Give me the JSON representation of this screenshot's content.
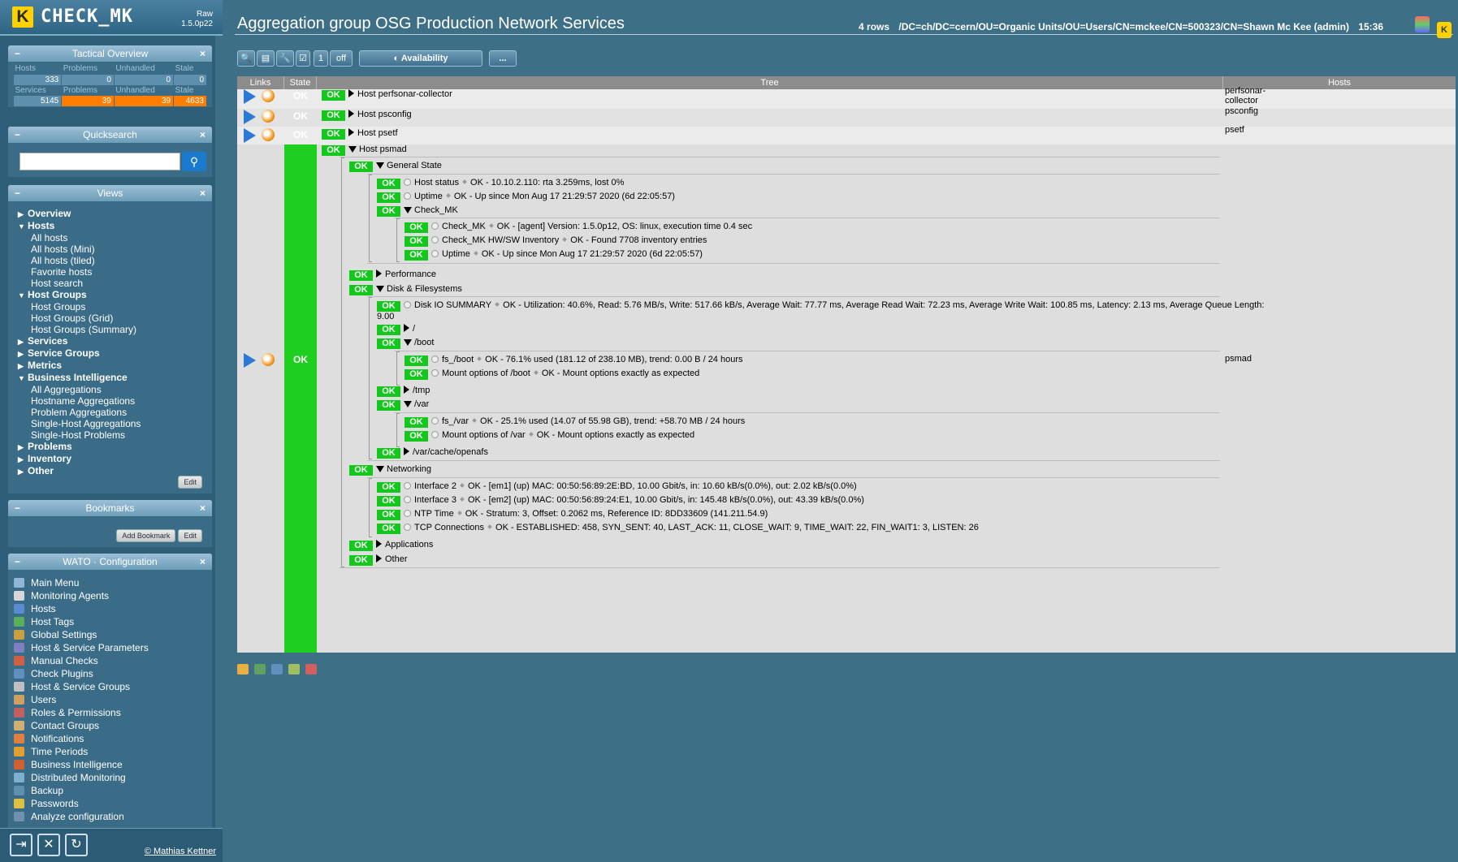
{
  "logo": {
    "letter": "K",
    "name": "CHECK_MK",
    "ver1": "Raw",
    "ver2": "1.5.0p22"
  },
  "tactical": {
    "title": "Tactical Overview",
    "hosts": {
      "labels": [
        "Hosts",
        "Problems",
        "Unhandled",
        "Stale"
      ],
      "values": [
        "333",
        "0",
        "0",
        "0"
      ]
    },
    "services": {
      "labels": [
        "Services",
        "Problems",
        "Unhandled",
        "Stale"
      ],
      "values": [
        "5145",
        "39",
        "39",
        "4633"
      ]
    }
  },
  "quicksearch": {
    "title": "Quicksearch",
    "placeholder": "",
    "search_icon": "magnifier"
  },
  "views": {
    "title": "Views",
    "edit": "Edit",
    "items": [
      {
        "label": "Overview",
        "kind": "group",
        "open": false
      },
      {
        "label": "Hosts",
        "kind": "group",
        "open": true
      },
      {
        "label": "All hosts",
        "kind": "sub"
      },
      {
        "label": "All hosts (Mini)",
        "kind": "sub"
      },
      {
        "label": "All hosts (tiled)",
        "kind": "sub"
      },
      {
        "label": "Favorite hosts",
        "kind": "sub"
      },
      {
        "label": "Host search",
        "kind": "sub"
      },
      {
        "label": "Host Groups",
        "kind": "group",
        "open": true
      },
      {
        "label": "Host Groups",
        "kind": "sub"
      },
      {
        "label": "Host Groups (Grid)",
        "kind": "sub"
      },
      {
        "label": "Host Groups (Summary)",
        "kind": "sub"
      },
      {
        "label": "Services",
        "kind": "group",
        "open": false
      },
      {
        "label": "Service Groups",
        "kind": "group",
        "open": false
      },
      {
        "label": "Metrics",
        "kind": "group",
        "open": false
      },
      {
        "label": "Business Intelligence",
        "kind": "group",
        "open": true
      },
      {
        "label": "All Aggregations",
        "kind": "sub"
      },
      {
        "label": "Hostname Aggregations",
        "kind": "sub"
      },
      {
        "label": "Problem Aggregations",
        "kind": "sub"
      },
      {
        "label": "Single-Host Aggregations",
        "kind": "sub"
      },
      {
        "label": "Single-Host Problems",
        "kind": "sub"
      },
      {
        "label": "Problems",
        "kind": "group",
        "open": false
      },
      {
        "label": "Inventory",
        "kind": "group",
        "open": false
      },
      {
        "label": "Other",
        "kind": "group",
        "open": false
      }
    ]
  },
  "bookmarks": {
    "title": "Bookmarks",
    "add": "Add Bookmark",
    "edit": "Edit"
  },
  "wato": {
    "title": "WATO · Configuration",
    "items": [
      {
        "label": "Main Menu",
        "color": "#8fb8d8"
      },
      {
        "label": "Monitoring Agents",
        "color": "#d8d8d8"
      },
      {
        "label": "Hosts",
        "color": "#5a8ad0"
      },
      {
        "label": "Host Tags",
        "color": "#5ab05a"
      },
      {
        "label": "Global Settings",
        "color": "#c8a040"
      },
      {
        "label": "Host & Service Parameters",
        "color": "#8080c0"
      },
      {
        "label": "Manual Checks",
        "color": "#d06040"
      },
      {
        "label": "Check Plugins",
        "color": "#6090c0"
      },
      {
        "label": "Host & Service Groups",
        "color": "#c0c0c0"
      },
      {
        "label": "Users",
        "color": "#d0a060"
      },
      {
        "label": "Roles & Permissions",
        "color": "#c06060"
      },
      {
        "label": "Contact Groups",
        "color": "#d0b070"
      },
      {
        "label": "Notifications",
        "color": "#e08040"
      },
      {
        "label": "Time Periods",
        "color": "#e0a030"
      },
      {
        "label": "Business Intelligence",
        "color": "#d06030"
      },
      {
        "label": "Distributed Monitoring",
        "color": "#80b0d0"
      },
      {
        "label": "Backup",
        "color": "#6090b0"
      },
      {
        "label": "Passwords",
        "color": "#e0c040"
      },
      {
        "label": "Analyze configuration",
        "color": "#7090b0"
      }
    ]
  },
  "footer": {
    "copyright": "© Mathias Kettner"
  },
  "header": {
    "title": "Aggregation group OSG Production Network Services",
    "rows": "4 rows",
    "path": "/DC=ch/DC=cern/OU=Organic Units/OU=Users/CN=mckee/CN=500323/CN=Shawn Mc Kee (admin)",
    "time": "15:36"
  },
  "toolbar": {
    "toggle_value": "1",
    "toggle_state": "off",
    "availability": "Availability",
    "more": "..."
  },
  "table": {
    "columns": [
      "Links",
      "State",
      "Tree",
      "Hosts"
    ],
    "state_ok": "OK",
    "hosts": [
      "perfsonar-collector",
      "psconfig",
      "psetf",
      "psmad"
    ],
    "tree": [
      {
        "label": "Host perfsonar-collector",
        "state": "OK"
      },
      {
        "label": "Host psconfig",
        "state": "OK"
      },
      {
        "label": "Host psetf",
        "state": "OK"
      },
      {
        "label": "Host psmad",
        "state": "OK"
      },
      {
        "label": "General State",
        "state": "OK"
      },
      {
        "label": "Host status",
        "state": "OK",
        "output": "OK - 10.10.2.110: rta 3.259ms, lost 0%"
      },
      {
        "label": "Uptime",
        "state": "OK",
        "output": "OK - Up since Mon Aug 17 21:29:57 2020 (6d 22:05:57)"
      },
      {
        "label": "Check_MK",
        "state": "OK"
      },
      {
        "label": "Check_MK",
        "state": "OK",
        "output": "OK - [agent] Version: 1.5.0p12, OS: linux, execution time 0.4 sec"
      },
      {
        "label": "Check_MK HW/SW Inventory",
        "state": "OK",
        "output": "OK - Found 7708 inventory entries"
      },
      {
        "label": "Uptime",
        "state": "OK",
        "output": "OK - Up since Mon Aug 17 21:29:57 2020 (6d 22:05:57)"
      },
      {
        "label": "Performance",
        "state": "OK"
      },
      {
        "label": "Disk & Filesystems",
        "state": "OK"
      },
      {
        "label": "Disk IO SUMMARY",
        "state": "OK",
        "output": "OK - Utilization: 40.6%, Read: 5.76 MB/s, Write: 517.66 kB/s, Average Wait: 77.77 ms, Average Read Wait: 72.23 ms, Average Write Wait: 100.85 ms, Latency: 2.13 ms, Average Queue Length:",
        "output2": "9.00"
      },
      {
        "label": "/",
        "state": "OK"
      },
      {
        "label": "/boot",
        "state": "OK"
      },
      {
        "label": "fs_/boot",
        "state": "OK",
        "output": "OK - 76.1% used (181.12 of 238.10 MB), trend: 0.00 B / 24 hours"
      },
      {
        "label": "Mount options of /boot",
        "state": "OK",
        "output": "OK - Mount options exactly as expected"
      },
      {
        "label": "/tmp",
        "state": "OK"
      },
      {
        "label": "/var",
        "state": "OK"
      },
      {
        "label": "fs_/var",
        "state": "OK",
        "output": "OK - 25.1% used (14.07 of 55.98 GB), trend: +58.70 MB / 24 hours"
      },
      {
        "label": "Mount options of /var",
        "state": "OK",
        "output": "OK - Mount options exactly as expected"
      },
      {
        "label": "/var/cache/openafs",
        "state": "OK"
      },
      {
        "label": "Networking",
        "state": "OK"
      },
      {
        "label": "Interface 2",
        "state": "OK",
        "output": "OK - [em1] (up) MAC: 00:50:56:89:2E:BD, 10.00 Gbit/s, in: 10.60 kB/s(0.0%), out: 2.02 kB/s(0.0%)"
      },
      {
        "label": "Interface 3",
        "state": "OK",
        "output": "OK - [em2] (up) MAC: 00:50:56:89:24:E1, 10.00 Gbit/s, in: 145.48 kB/s(0.0%), out: 43.39 kB/s(0.0%)"
      },
      {
        "label": "NTP Time",
        "state": "OK",
        "output": "OK - Stratum: 3, Offset: 0.2062 ms, Reference ID: 8DD33609 (141.211.54.9)"
      },
      {
        "label": "TCP Connections",
        "state": "OK",
        "output": "OK - ESTABLISHED: 458, SYN_SENT: 40, LAST_ACK: 11, CLOSE_WAIT: 9, TIME_WAIT: 22, FIN_WAIT1: 3, LISTEN: 26"
      },
      {
        "label": "Applications",
        "state": "OK"
      },
      {
        "label": "Other",
        "state": "OK"
      }
    ]
  }
}
